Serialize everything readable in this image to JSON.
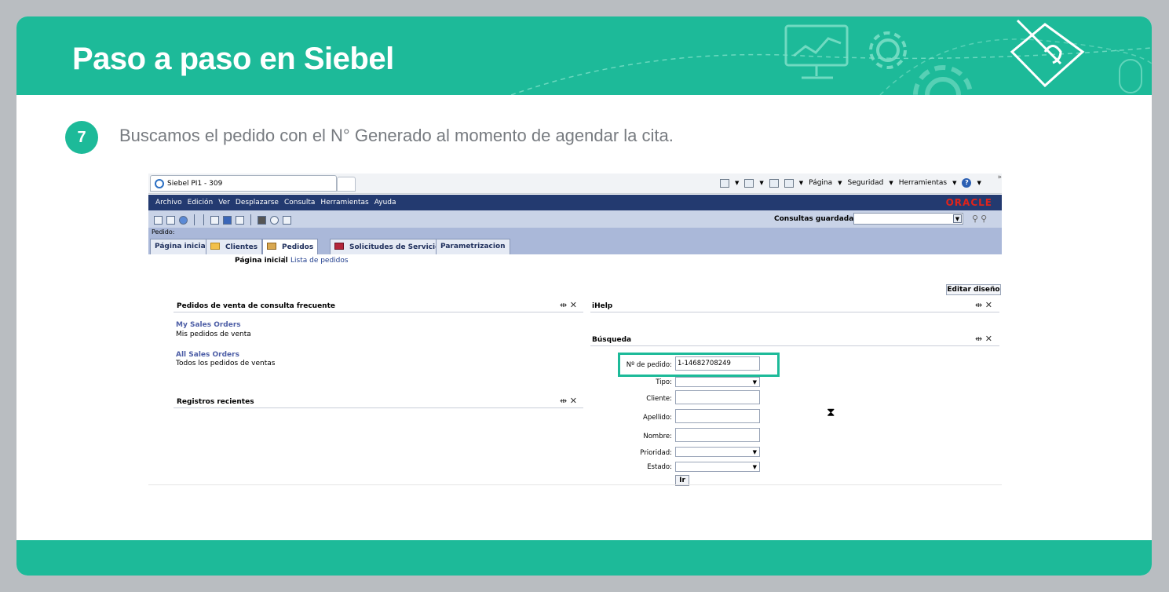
{
  "slide": {
    "title": "Paso a paso en Siebel",
    "step_number": "7",
    "step_text": "Buscamos el pedido con el N° Generado al momento de agendar la cita."
  },
  "browser": {
    "tab_title": "Siebel PI1 - 309",
    "commands": [
      "Página",
      "Seguridad",
      "Herramientas"
    ]
  },
  "siebel": {
    "menu": [
      "Archivo",
      "Edición",
      "Ver",
      "Desplazarse",
      "Consulta",
      "Herramientas",
      "Ayuda"
    ],
    "brand": "ORACLE",
    "saved_queries_label": "Consultas guardadas:",
    "context_label": "Pedido:",
    "tabs": [
      "Página inicial",
      "Clientes",
      "Pedidos",
      "Solicitudes de Servicio",
      "Parametrizacion"
    ],
    "subnav": {
      "active": "Página inicial",
      "separator": "|",
      "link": "Lista de pedidos"
    },
    "edit_layout": "Editar diseño",
    "frequent_orders": {
      "title": "Pedidos de venta de consulta frecuente",
      "items": [
        {
          "link": "My Sales Orders",
          "desc": "Mis pedidos de venta"
        },
        {
          "link": "All Sales Orders",
          "desc": "Todos los pedidos de ventas"
        }
      ]
    },
    "recent_records": {
      "title": "Registros recientes"
    },
    "ihelp": {
      "title": "iHelp"
    },
    "search": {
      "title": "Búsqueda",
      "fields": {
        "order_no": {
          "label": "Nº de pedido:",
          "value": "1-14682708249"
        },
        "type": {
          "label": "Tipo:"
        },
        "client": {
          "label": "Cliente:"
        },
        "surname": {
          "label": "Apellido:"
        },
        "name": {
          "label": "Nombre:"
        },
        "priority": {
          "label": "Prioridad:"
        },
        "status": {
          "label": "Estado:"
        }
      },
      "go_button": "Ir"
    }
  },
  "colors": {
    "accent": "#1dba99",
    "siebel_menu": "#233a70",
    "oracle_red": "#e2231a"
  }
}
